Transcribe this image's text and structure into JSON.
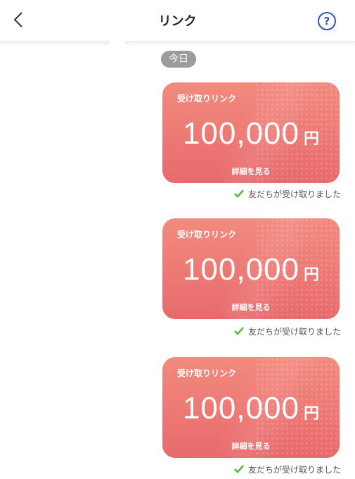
{
  "header": {
    "title": "リンク",
    "help_icon_label": "?"
  },
  "date_chip": "今日",
  "cards": [
    {
      "label": "受け取りリンク",
      "amount": "100,000",
      "unit": "円",
      "detail": "詳細を見る",
      "status": "友だちが受け取りました"
    },
    {
      "label": "受け取りリンク",
      "amount": "100,000",
      "unit": "円",
      "detail": "詳細を見る",
      "status": "友だちが受け取りました"
    },
    {
      "label": "受け取りリンク",
      "amount": "100,000",
      "unit": "円",
      "detail": "詳細を見る",
      "status": "友だちが受け取りました"
    }
  ],
  "colors": {
    "card_top": "#f28a7f",
    "card_bottom": "#e86a6c",
    "check": "#5cb53b",
    "help": "#2b56b8",
    "chip": "#9c9c9c"
  },
  "icons": {
    "back": "chevron-left-icon",
    "help": "question-circle-icon",
    "check": "check-icon"
  }
}
